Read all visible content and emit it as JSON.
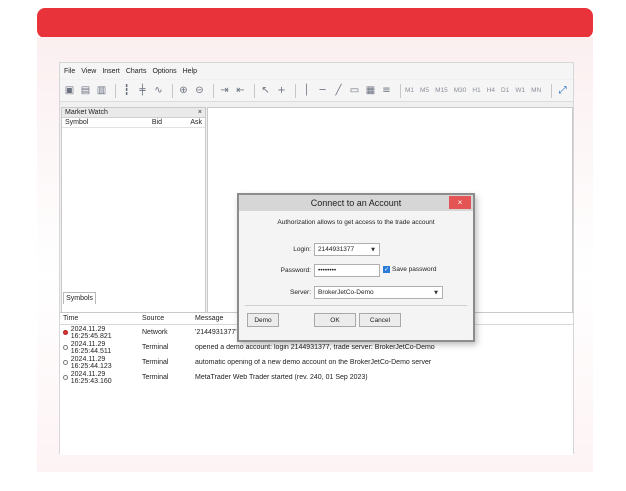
{
  "menu": [
    "File",
    "View",
    "Insert",
    "Charts",
    "Options",
    "Help"
  ],
  "toolbar": {
    "timeframes": [
      "M1",
      "M5",
      "M15",
      "M30",
      "H1",
      "H4",
      "D1",
      "W1",
      "MN"
    ]
  },
  "market_watch": {
    "title": "Market Watch",
    "close": "×",
    "columns": [
      "Symbol",
      "Bid",
      "Ask"
    ],
    "tab": "Symbols"
  },
  "journal": {
    "columns": [
      "Time",
      "Source",
      "Message"
    ],
    "rows": [
      {
        "time": "2024.11.29 16:25:45.821",
        "source": "Network",
        "message": "'2144931377': ",
        "status": "error"
      },
      {
        "time": "2024.11.29 16:25:44.511",
        "source": "Terminal",
        "message": "opened a demo account: login 2144931377, trade server: BrokerJetCo-Demo",
        "status": "info"
      },
      {
        "time": "2024.11.29 16:25:44.123",
        "source": "Terminal",
        "message": "automatic opening of a new demo account on the BrokerJetCo-Demo server",
        "status": "info"
      },
      {
        "time": "2024.11.29 16:25:43.160",
        "source": "Terminal",
        "message": "MetaTrader Web Trader started (rev. 240, 01 Sep 2023)",
        "status": "info"
      }
    ]
  },
  "dialog": {
    "title": "Connect to an Account",
    "close": "×",
    "description": "Authorization allows to get access to the trade account",
    "login_label": "Login:",
    "login_value": "2144931377",
    "password_label": "Password:",
    "password_value": "••••••••",
    "save_password_label": "Save password",
    "save_password_checked": true,
    "server_label": "Server:",
    "server_value": "BrokerJetCo-Demo",
    "demo_button": "Demo",
    "ok_button": "OK",
    "cancel_button": "Cancel"
  },
  "colors": {
    "brand": "#e8333a",
    "close_button": "#e45454",
    "checkbox": "#2d7bd9"
  }
}
